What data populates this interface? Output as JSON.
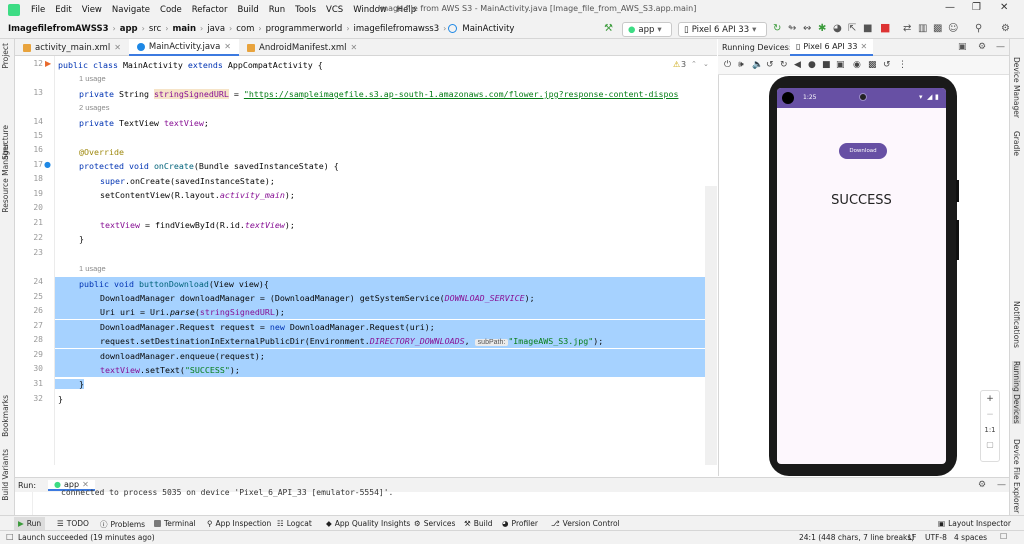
{
  "menu": {
    "items": [
      "File",
      "Edit",
      "View",
      "Navigate",
      "Code",
      "Refactor",
      "Build",
      "Run",
      "Tools",
      "VCS",
      "Window",
      "Help"
    ],
    "title": "Image file from AWS S3 - MainActivity.java [Image_file_from_AWS_S3.app.main]"
  },
  "breadcrumb": [
    "ImagefilefromAWSS3",
    "app",
    "src",
    "main",
    "java",
    "com",
    "programmerworld",
    "imagefilefromawss3",
    "MainActivity"
  ],
  "toolbar": {
    "config": "app",
    "device": "Pixel 6 API 33"
  },
  "left_tools": [
    "Project",
    "Structure",
    "Resource Manager",
    "Bookmarks",
    "Build Variants"
  ],
  "right_tools": [
    "Device Manager",
    "Gradle",
    "Notifications",
    "Running Devices",
    "Device File Explorer"
  ],
  "tabs": [
    {
      "label": "activity_main.xml",
      "color": "#e8a33d"
    },
    {
      "label": "MainActivity.java",
      "color": "#1e88e5"
    },
    {
      "label": "AndroidManifest.xml",
      "color": "#e8a33d"
    }
  ],
  "editor": {
    "warn_count": "3",
    "hints": {
      "usage1": "1 usage",
      "usages2": "2 usages",
      "usage3": "1 usage"
    },
    "lines": [
      "12",
      "13",
      "14",
      "15",
      "16",
      "17",
      "18",
      "19",
      "20",
      "21",
      "22",
      "23",
      "24",
      "25",
      "26",
      "27",
      "28",
      "29",
      "30",
      "31",
      "32"
    ],
    "code": {
      "l12_k1": "public class ",
      "l12_n": "MainActivity ",
      "l12_k2": "extends ",
      "l12_t": "AppCompatActivity {",
      "l13_k": "private ",
      "l13_t": "String ",
      "l13_v": "stringSignedURL",
      "l13_eq": " = ",
      "l13_s": "\"https://sampleimagefile.s3.ap-south-1.amazonaws.com/flower.jpg?response-content-dispos",
      "l14_k": "private ",
      "l14_t": "TextView ",
      "l14_v": "textView",
      "l14_e": ";",
      "l16": "@Override",
      "l17_k": "protected void ",
      "l17_m": "onCreate",
      "l17_r": "(Bundle savedInstanceState) {",
      "l18_k": "super",
      "l18_r": ".onCreate(savedInstanceState);",
      "l19_a": "setContentView(R.layout.",
      "l19_f": "activity_main",
      "l19_e": ");",
      "l21_f": "textView",
      "l21_a": " = findViewById(R.id.",
      "l21_fi": "textView",
      "l21_e": ");",
      "l22": "}",
      "l24_k": "public void ",
      "l24_m": "buttonDownload",
      "l24_r": "(View view){",
      "l25_a": "DownloadManager downloadManager = (DownloadManager) getSystemService(",
      "l25_fi": "DOWNLOAD_SERVICE",
      "l25_e": ");",
      "l26_a": "Uri uri = Uri.",
      "l26_i": "parse",
      "l26_b": "(",
      "l26_f": "stringSignedURL",
      "l26_e": ");",
      "l27_a": "DownloadManager.Request request = ",
      "l27_k": "new ",
      "l27_b": "DownloadManager.Request(uri);",
      "l28_a": "request.setDestinationInExternalPublicDir(Environment.",
      "l28_fi": "DIRECTORY_DOWNLOADS",
      "l28_b": ", ",
      "l28_ph": "subPath:",
      "l28_s": "\"ImageAWS_S3.jpg\"",
      "l28_e": ");",
      "l29": "downloadManager.enqueue(request);",
      "l30_f": "textView",
      "l30_a": ".setText(",
      "l30_s": "\"SUCCESS\"",
      "l30_e": ");",
      "l31": "}",
      "l32": "}"
    }
  },
  "running_devices": {
    "title": "Running Devices:",
    "tab": "Pixel 6 API 33"
  },
  "phone": {
    "time": "1:25",
    "button": "Download",
    "result": "SUCCESS",
    "zoom_ratio": "1:1"
  },
  "run": {
    "label": "Run:",
    "config": "app",
    "console": "connected to process 5035 on device 'Pixel_6_API_33 [emulator-5554]'."
  },
  "bottom_tools": [
    "Run",
    "TODO",
    "Problems",
    "Terminal",
    "App Inspection",
    "Logcat",
    "App Quality Insights",
    "Services",
    "Build",
    "Profiler",
    "Version Control",
    "Layout Inspector"
  ],
  "status": {
    "message": "Launch succeeded (19 minutes ago)",
    "position": "24:1 (448 chars, 7 line breaks)",
    "line_sep": "LF",
    "encoding": "UTF-8",
    "indent": "4 spaces"
  }
}
